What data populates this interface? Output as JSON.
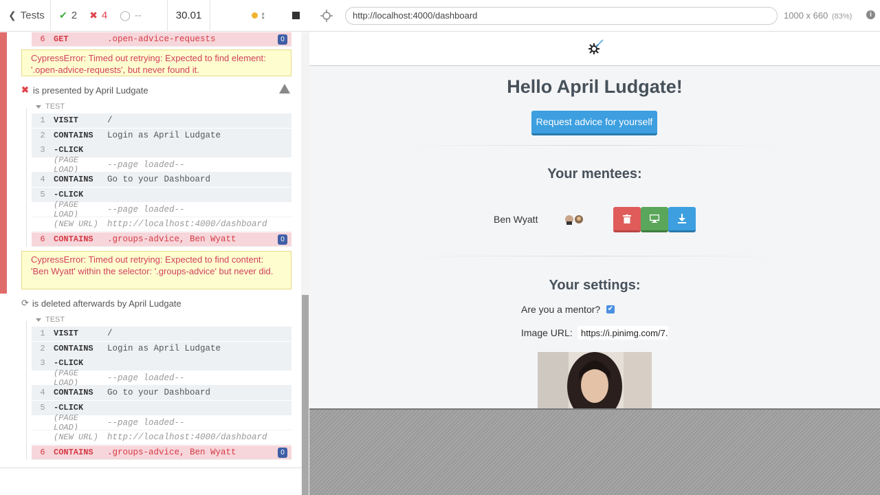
{
  "reporter": {
    "header": {
      "tests_label": "Tests",
      "passed": "2",
      "failed": "4",
      "pending": "--",
      "duration": "30.01"
    },
    "blocks": {
      "top_cmd": {
        "num": "6",
        "name": "GET",
        "msg": ".open-advice-requests",
        "badge": "0"
      },
      "err1": "CypressError: Timed out retrying: Expected to find element: '.open-advice-requests', but never found it.",
      "test2_title": "is presented by April Ludgate",
      "test_label": "TEST",
      "test2_cmds": [
        {
          "num": "1",
          "name": "VISIT",
          "msg": "/"
        },
        {
          "num": "2",
          "name": "CONTAINS",
          "msg": "Login as April Ludgate"
        },
        {
          "num": "3",
          "name": "-CLICK",
          "msg": ""
        },
        {
          "num": "",
          "name": "(PAGE LOAD)",
          "msg": "--page loaded--"
        },
        {
          "num": "4",
          "name": "CONTAINS",
          "msg": "Go to your Dashboard"
        },
        {
          "num": "5",
          "name": "-CLICK",
          "msg": ""
        },
        {
          "num": "",
          "name": "(PAGE LOAD)",
          "msg": "--page loaded--"
        },
        {
          "num": "",
          "name": "(NEW URL)",
          "msg": "http://localhost:4000/dashboard"
        },
        {
          "num": "6",
          "name": "CONTAINS",
          "msg": ".groups-advice, Ben Wyatt",
          "badge": "0"
        }
      ],
      "err2": "CypressError: Timed out retrying: Expected to find content: 'Ben Wyatt' within the selector: '.groups-advice' but never did.",
      "test3_title": "is deleted afterwards by April Ludgate",
      "test3_cmds": [
        {
          "num": "1",
          "name": "VISIT",
          "msg": "/"
        },
        {
          "num": "2",
          "name": "CONTAINS",
          "msg": "Login as April Ludgate"
        },
        {
          "num": "3",
          "name": "-CLICK",
          "msg": ""
        },
        {
          "num": "",
          "name": "(PAGE LOAD)",
          "msg": "--page loaded--"
        },
        {
          "num": "4",
          "name": "CONTAINS",
          "msg": "Go to your Dashboard"
        },
        {
          "num": "5",
          "name": "-CLICK",
          "msg": ""
        },
        {
          "num": "",
          "name": "(PAGE LOAD)",
          "msg": "--page loaded--"
        },
        {
          "num": "",
          "name": "(NEW URL)",
          "msg": "http://localhost:4000/dashboard"
        },
        {
          "num": "6",
          "name": "CONTAINS",
          "msg": ".groups-advice, Ben Wyatt",
          "badge": "0"
        }
      ]
    }
  },
  "runner": {
    "url": "http://localhost:4000/dashboard",
    "viewport": "1000 x 660",
    "scale": "(83%)"
  },
  "app": {
    "greeting": "Hello April Ludgate!",
    "request_button": "Request advice for yourself",
    "mentees_heading": "Your mentees:",
    "mentee_name": "Ben Wyatt",
    "settings_heading": "Your settings:",
    "mentor_label": "Are you a mentor?",
    "image_url_label": "Image URL:",
    "image_url_value": "https://i.pinimg.com/7..."
  }
}
